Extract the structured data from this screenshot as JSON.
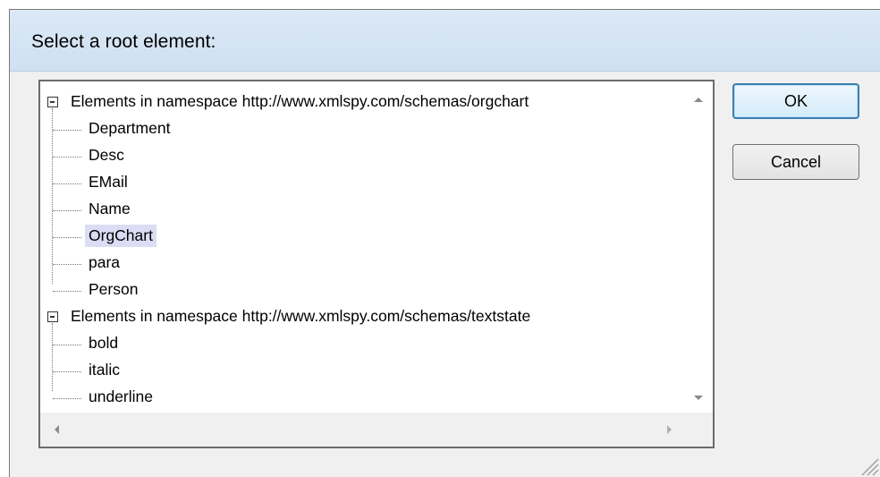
{
  "dialog": {
    "title": "Select a root element:"
  },
  "tree": {
    "namespaces": [
      {
        "label": "Elements in namespace http://www.xmlspy.com/schemas/orgchart",
        "expanded": true,
        "items": [
          "Department",
          "Desc",
          "EMail",
          "Name",
          "OrgChart",
          "para",
          "Person"
        ]
      },
      {
        "label": "Elements in namespace http://www.xmlspy.com/schemas/textstate",
        "expanded": true,
        "items": [
          "bold",
          "italic",
          "underline"
        ]
      }
    ],
    "selected_item": "OrgChart"
  },
  "buttons": {
    "ok_label": "OK",
    "cancel_label": "Cancel"
  },
  "colors": {
    "header_bg": "#d5e5f4",
    "selection_bg": "#dcdcf5",
    "ok_border": "#3c7fb1"
  }
}
